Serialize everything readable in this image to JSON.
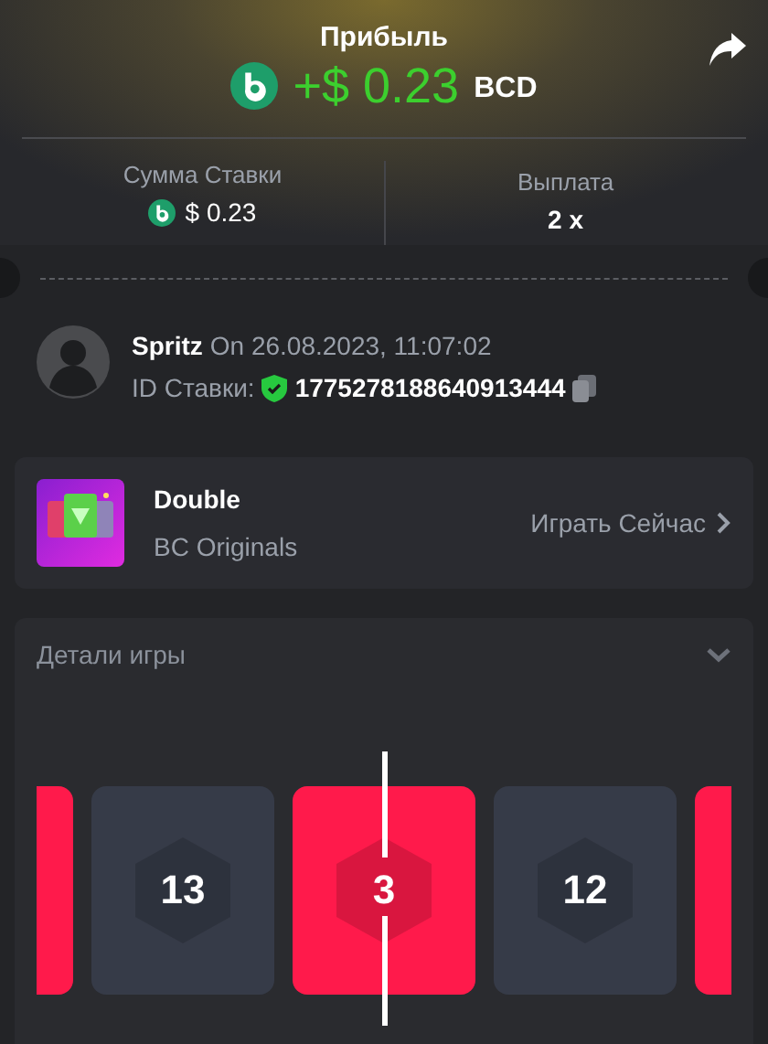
{
  "header": {
    "title": "Прибыль",
    "profit": "+$ 0.23",
    "currency": "BCD"
  },
  "stats": [
    {
      "label": "Сумма Ставки",
      "value": "$ 0.23",
      "coin": true
    },
    {
      "label": "Выплата",
      "value": "2 x",
      "coin": false
    }
  ],
  "bet": {
    "user": "Spritz",
    "date": "On 26.08.2023, 11:07:02",
    "id_label": "ID Ставки:",
    "id": "1775278188640913444",
    "verified": true
  },
  "game": {
    "name": "Double",
    "provider": "BC Originals",
    "action": "Играть Сейчас"
  },
  "details": {
    "title": "Детали игры",
    "expanded": true,
    "tiles": [
      {
        "color": "#ff1a4b"
      },
      {
        "number": "13",
        "color": "#363b48"
      },
      {
        "number": "3",
        "color": "#ff1a4b"
      },
      {
        "number": "12",
        "color": "#363b48"
      },
      {
        "color": "#ff1a4b"
      }
    ]
  }
}
